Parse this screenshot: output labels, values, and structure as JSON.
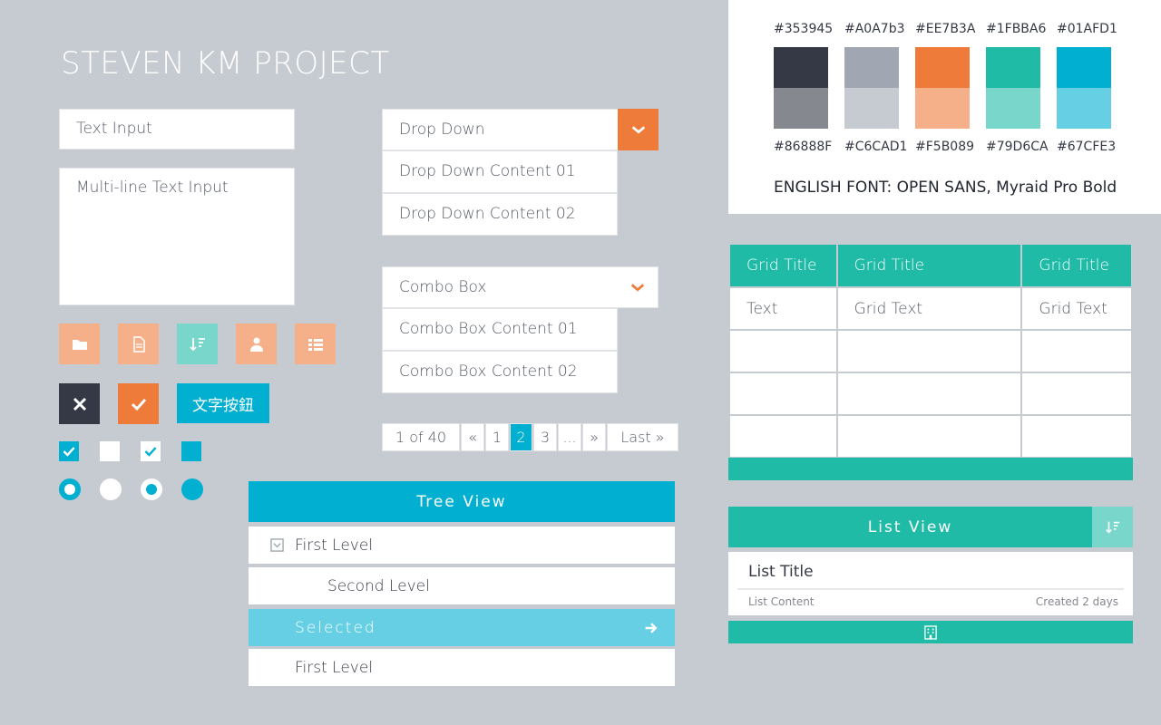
{
  "app_title": "STEVEN KM PROJECT",
  "inputs": {
    "text_placeholder": "Text Input",
    "multiline_placeholder": "Multi-line Text Input"
  },
  "icon_buttons": [
    {
      "name": "folder-icon",
      "color": "#F5B089"
    },
    {
      "name": "document-icon",
      "color": "#F5B089"
    },
    {
      "name": "sort-icon",
      "color": "#79D6CA"
    },
    {
      "name": "user-icon",
      "color": "#F5B089"
    },
    {
      "name": "list-icon",
      "color": "#F5B089"
    }
  ],
  "action_buttons": {
    "close": "close-icon",
    "confirm": "check-icon",
    "text_button_label": "文字按鈕"
  },
  "dropdown": {
    "label": "Drop Down",
    "items": [
      "Drop Down Content 01",
      "Drop Down Content 02"
    ]
  },
  "combobox": {
    "label": "Combo Box",
    "items": [
      "Combo Box Content 01",
      "Combo Box Content 02"
    ]
  },
  "pagination": {
    "summary": "1 of 40",
    "first": "«",
    "pages": [
      "1",
      "2",
      "3",
      "..."
    ],
    "active_page": "2",
    "next": "»",
    "last": "Last »"
  },
  "tree": {
    "title": "Tree View",
    "rows": [
      "First Level",
      "Second Level",
      "Selected",
      "First Level"
    ]
  },
  "palette": {
    "swatches": [
      {
        "top": "#353945",
        "bottom": "#86888F"
      },
      {
        "top": "#A0A7b3",
        "bottom": "#C6CAD1"
      },
      {
        "top": "#EE7B3A",
        "bottom": "#F5B089"
      },
      {
        "top": "#1FBBA6",
        "bottom": "#79D6CA"
      },
      {
        "top": "#01AFD1",
        "bottom": "#67CFE3"
      }
    ],
    "font_note": "ENGLISH FONT: OPEN SANS, Myraid Pro Bold"
  },
  "grid": {
    "headers": [
      "Grid Title",
      "Grid Title",
      "Grid Title"
    ],
    "rows": [
      [
        "Text",
        "Grid Text",
        "Grid Text"
      ],
      [
        "",
        "",
        ""
      ],
      [
        "",
        "",
        ""
      ],
      [
        "",
        "",
        ""
      ]
    ]
  },
  "list_view": {
    "title": "List View",
    "item_title": "List Title",
    "item_content": "List Content",
    "item_created": "Created 2 days"
  }
}
